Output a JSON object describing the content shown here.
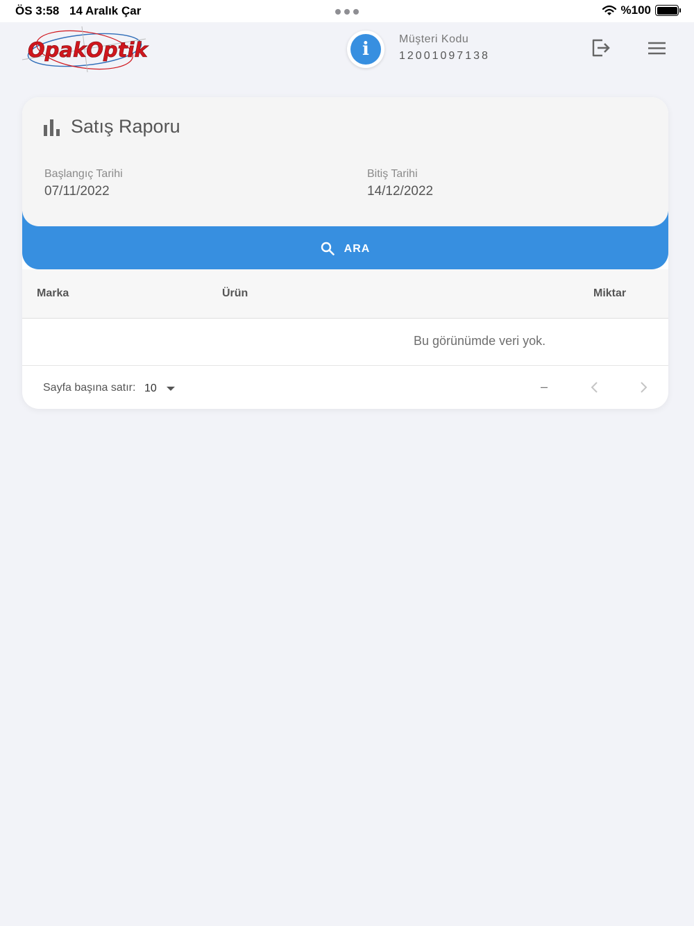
{
  "status_bar": {
    "time": "ÖS 3:58",
    "date": "14 Aralık Çar",
    "battery": "%100"
  },
  "header": {
    "logo_text": "OpakOptik",
    "customer_label": "Müşteri Kodu",
    "customer_code": "12001097138",
    "info_glyph": "i"
  },
  "report": {
    "title": "Satış Raporu",
    "start_label": "Başlangıç Tarihi",
    "start_value": "07/11/2022",
    "end_label": "Bitiş Tarihi",
    "end_value": "14/12/2022",
    "search_label": "ARA"
  },
  "table": {
    "columns": [
      "Marka",
      "Ürün",
      "Miktar"
    ],
    "empty_message": "Bu görünümde veri yok."
  },
  "pagination": {
    "rows_per_page_label": "Sayfa başına satır:",
    "rows_per_page_value": "10",
    "range": "–"
  },
  "colors": {
    "accent": "#378fe0",
    "logo_red": "#d0161d",
    "background": "#f2f3f8"
  },
  "icons": {
    "title": "bar-chart-icon",
    "search": "search-icon",
    "logout": "logout-icon",
    "menu": "hamburger-menu-icon",
    "info": "info-icon",
    "prev": "chevron-left-icon",
    "next": "chevron-right-icon"
  }
}
